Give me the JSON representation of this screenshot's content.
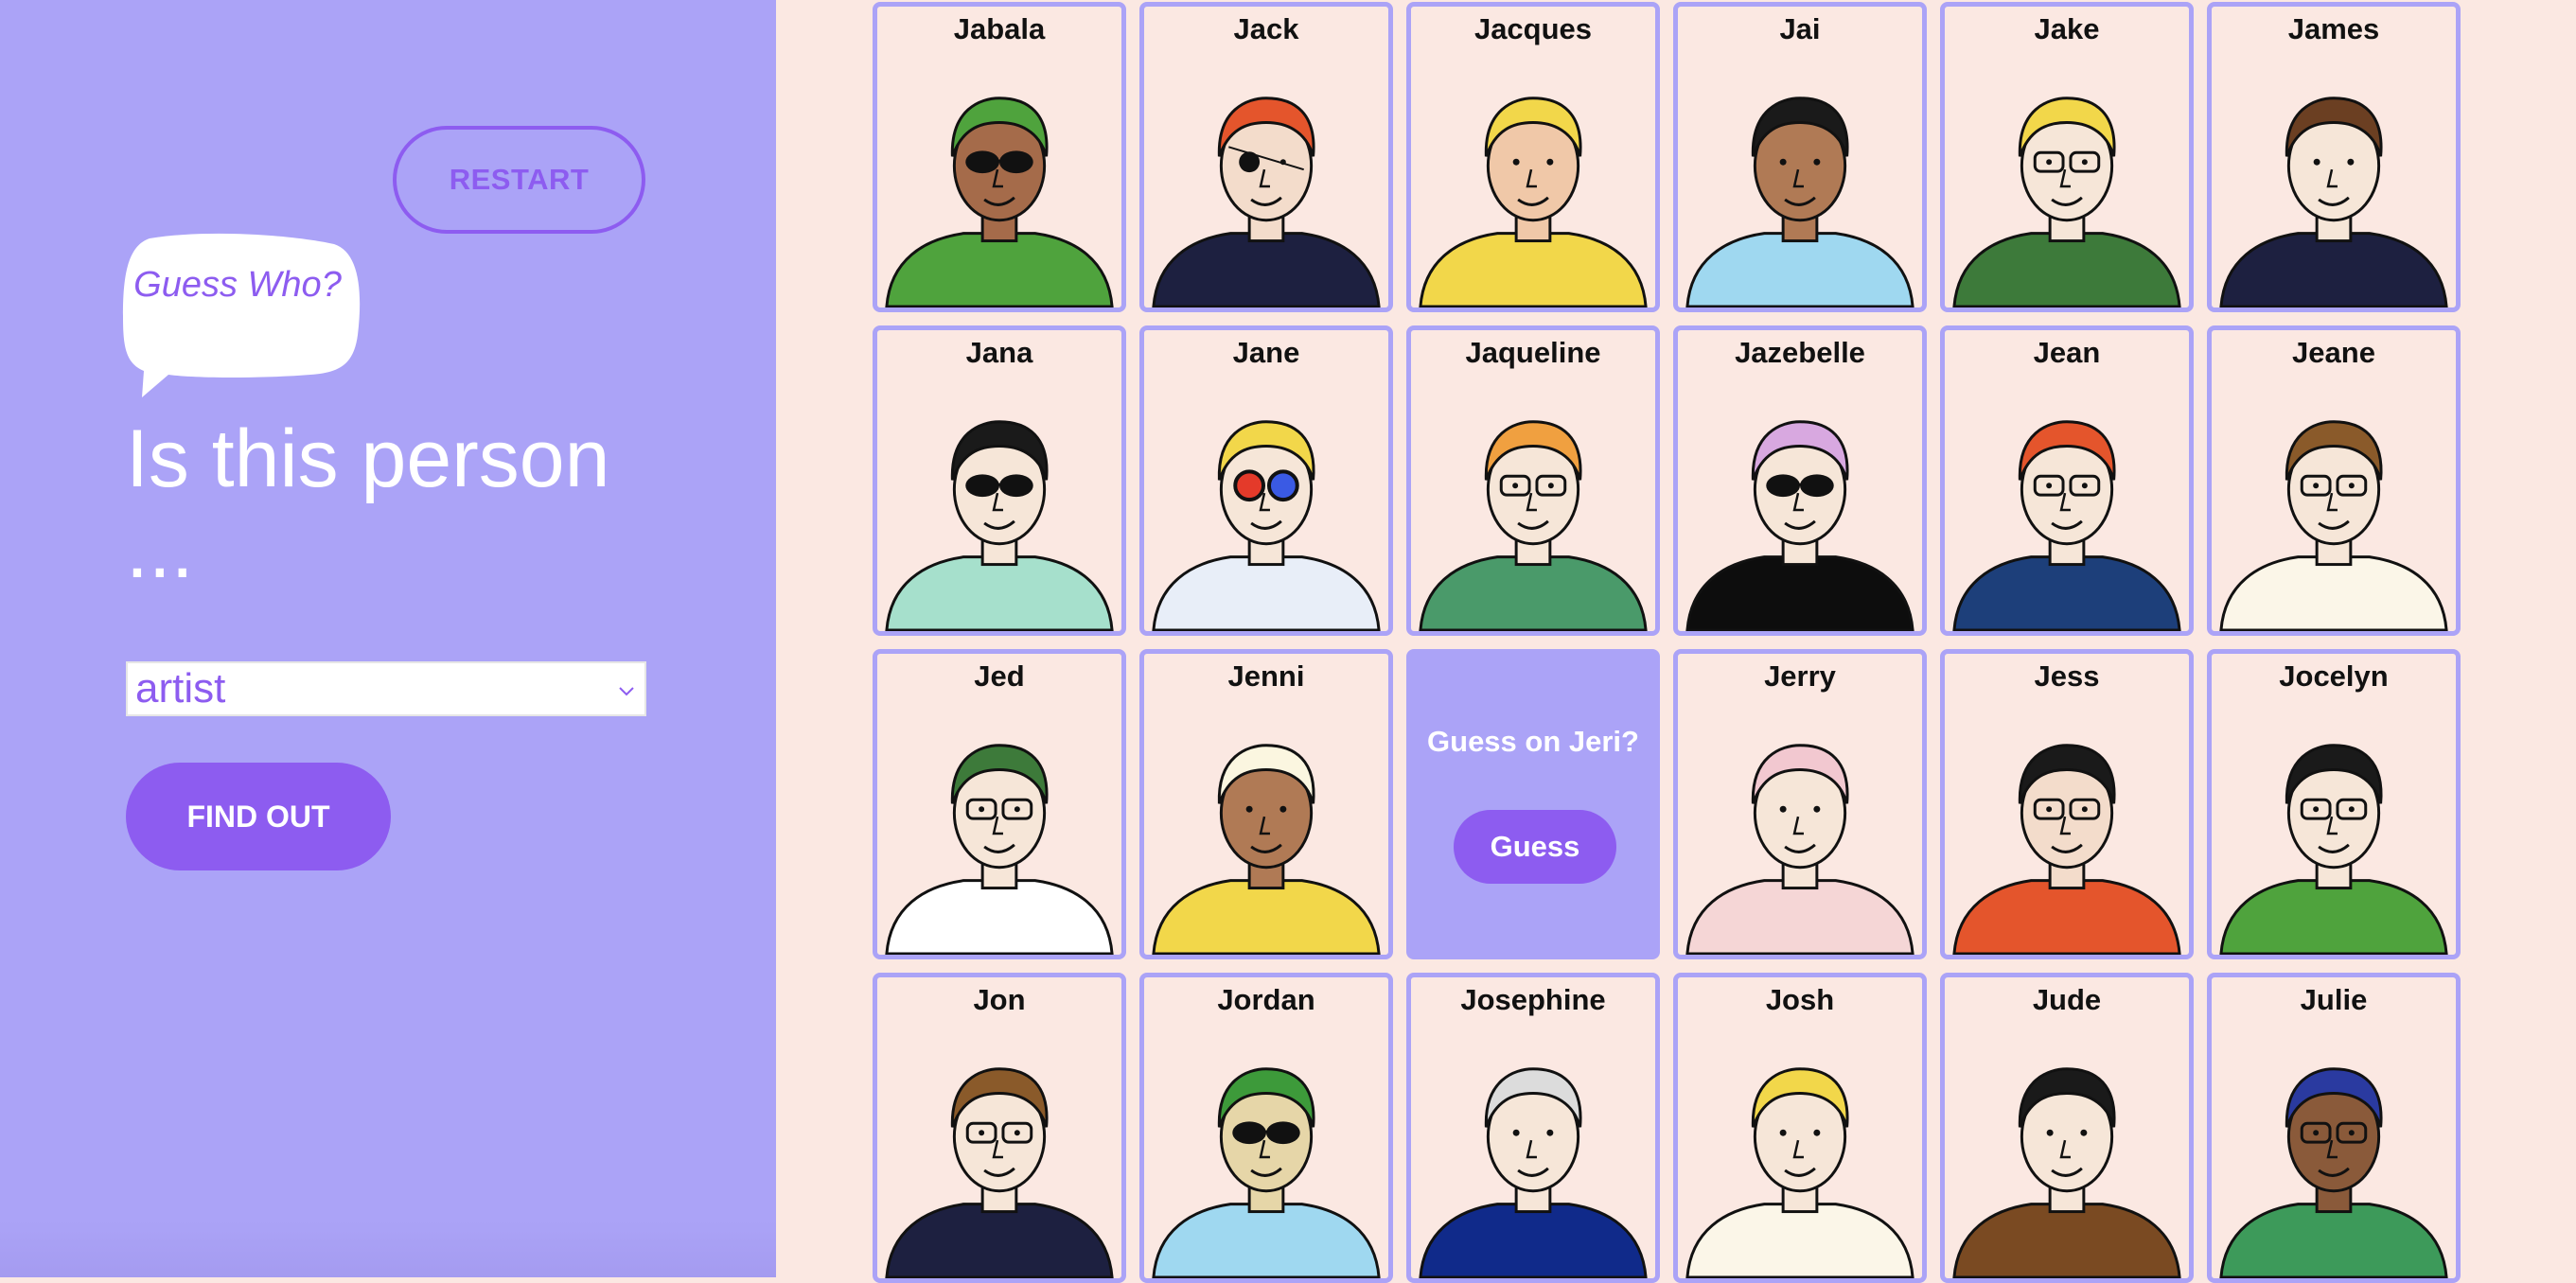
{
  "sidebar": {
    "restart_label": "RESTART",
    "bubble_text": "Guess Who?",
    "title": "Is this person ...",
    "select_value": "artist",
    "find_label": "FIND OUT"
  },
  "colors": {
    "accent": "#8d5cf0",
    "sidebar_bg": "#aba3f7",
    "card_bg": "#fbe8e2",
    "card_border": "#aba3f7"
  },
  "grid": {
    "cards": [
      {
        "name": "Jabala",
        "skin": "#a56b4a",
        "hair": "#4fa33d",
        "shirt": "#4fa33d",
        "accessory": "sunglasses"
      },
      {
        "name": "Jack",
        "skin": "#f3dccb",
        "hair": "#e4552c",
        "shirt": "#1d2040",
        "accessory": "eyepatch"
      },
      {
        "name": "Jacques",
        "skin": "#f0c8a8",
        "hair": "#f2d74a",
        "shirt": "#f2d74a",
        "accessory": "none"
      },
      {
        "name": "Jai",
        "skin": "#b07a55",
        "hair": "#1a1a1a",
        "shirt": "#9fd8f0",
        "accessory": "none"
      },
      {
        "name": "Jake",
        "skin": "#f6e6d8",
        "hair": "#f2d74a",
        "shirt": "#3d7a3a",
        "accessory": "glasses"
      },
      {
        "name": "James",
        "skin": "#f6e6d8",
        "hair": "#6b3f22",
        "shirt": "#1d2040",
        "accessory": "none"
      },
      {
        "name": "Jana",
        "skin": "#f6e6d8",
        "hair": "#1a1a1a",
        "shirt": "#a6e0cc",
        "accessory": "sunglasses"
      },
      {
        "name": "Jane",
        "skin": "#f6e6d8",
        "hair": "#f2d74a",
        "shirt": "#e8eef8",
        "accessory": "3dglasses"
      },
      {
        "name": "Jaqueline",
        "skin": "#f6e6d8",
        "hair": "#f0a040",
        "shirt": "#4a9a6a",
        "accessory": "glasses"
      },
      {
        "name": "Jazebelle",
        "skin": "#f6e6d8",
        "hair": "#d8a8e0",
        "shirt": "#0d0d0d",
        "accessory": "sunglasses"
      },
      {
        "name": "Jean",
        "skin": "#f6e6d8",
        "hair": "#e4552c",
        "shirt": "#1d3f7a",
        "accessory": "glasses"
      },
      {
        "name": "Jeane",
        "skin": "#f6e6d8",
        "hair": "#8a5a2a",
        "shirt": "#fbf6e8",
        "accessory": "glasses"
      },
      {
        "name": "Jed",
        "skin": "#f6e6d8",
        "hair": "#3d7a3a",
        "shirt": "#ffffff",
        "accessory": "glasses"
      },
      {
        "name": "Jenni",
        "skin": "#b07a55",
        "hair": "#fbf6e0",
        "shirt": "#f2d74a",
        "accessory": "none"
      },
      {
        "name": "Jeri",
        "guess": true,
        "guess_text": "Guess on Jeri?",
        "guess_label": "Guess"
      },
      {
        "name": "Jerry",
        "skin": "#f6e6d8",
        "hair": "#f2c8d0",
        "shirt": "#f5d6d6",
        "accessory": "none"
      },
      {
        "name": "Jess",
        "skin": "#f3dccb",
        "hair": "#1a1a1a",
        "shirt": "#e4552c",
        "accessory": "glasses"
      },
      {
        "name": "Jocelyn",
        "skin": "#f6e6d8",
        "hair": "#1a1a1a",
        "shirt": "#4fa33d",
        "accessory": "glasses"
      },
      {
        "name": "Jon",
        "skin": "#f6e6d8",
        "hair": "#8a5a2a",
        "shirt": "#1d2040",
        "accessory": "glasses"
      },
      {
        "name": "Jordan",
        "skin": "#e6d6a8",
        "hair": "#3d9a3a",
        "shirt": "#9fd8f0",
        "accessory": "sunglasses"
      },
      {
        "name": "Josephine",
        "skin": "#f6e6d8",
        "hair": "#dcdcdc",
        "shirt": "#102a8a",
        "accessory": "none"
      },
      {
        "name": "Josh",
        "skin": "#f6e6d8",
        "hair": "#f2d74a",
        "shirt": "#fbf6e8",
        "accessory": "none"
      },
      {
        "name": "Jude",
        "skin": "#f6e6d8",
        "hair": "#1a1a1a",
        "shirt": "#7a4a22",
        "accessory": "none"
      },
      {
        "name": "Julie",
        "skin": "#8a5a3a",
        "hair": "#2a3aa0",
        "shirt": "#3d9a5a",
        "accessory": "glasses"
      }
    ]
  }
}
